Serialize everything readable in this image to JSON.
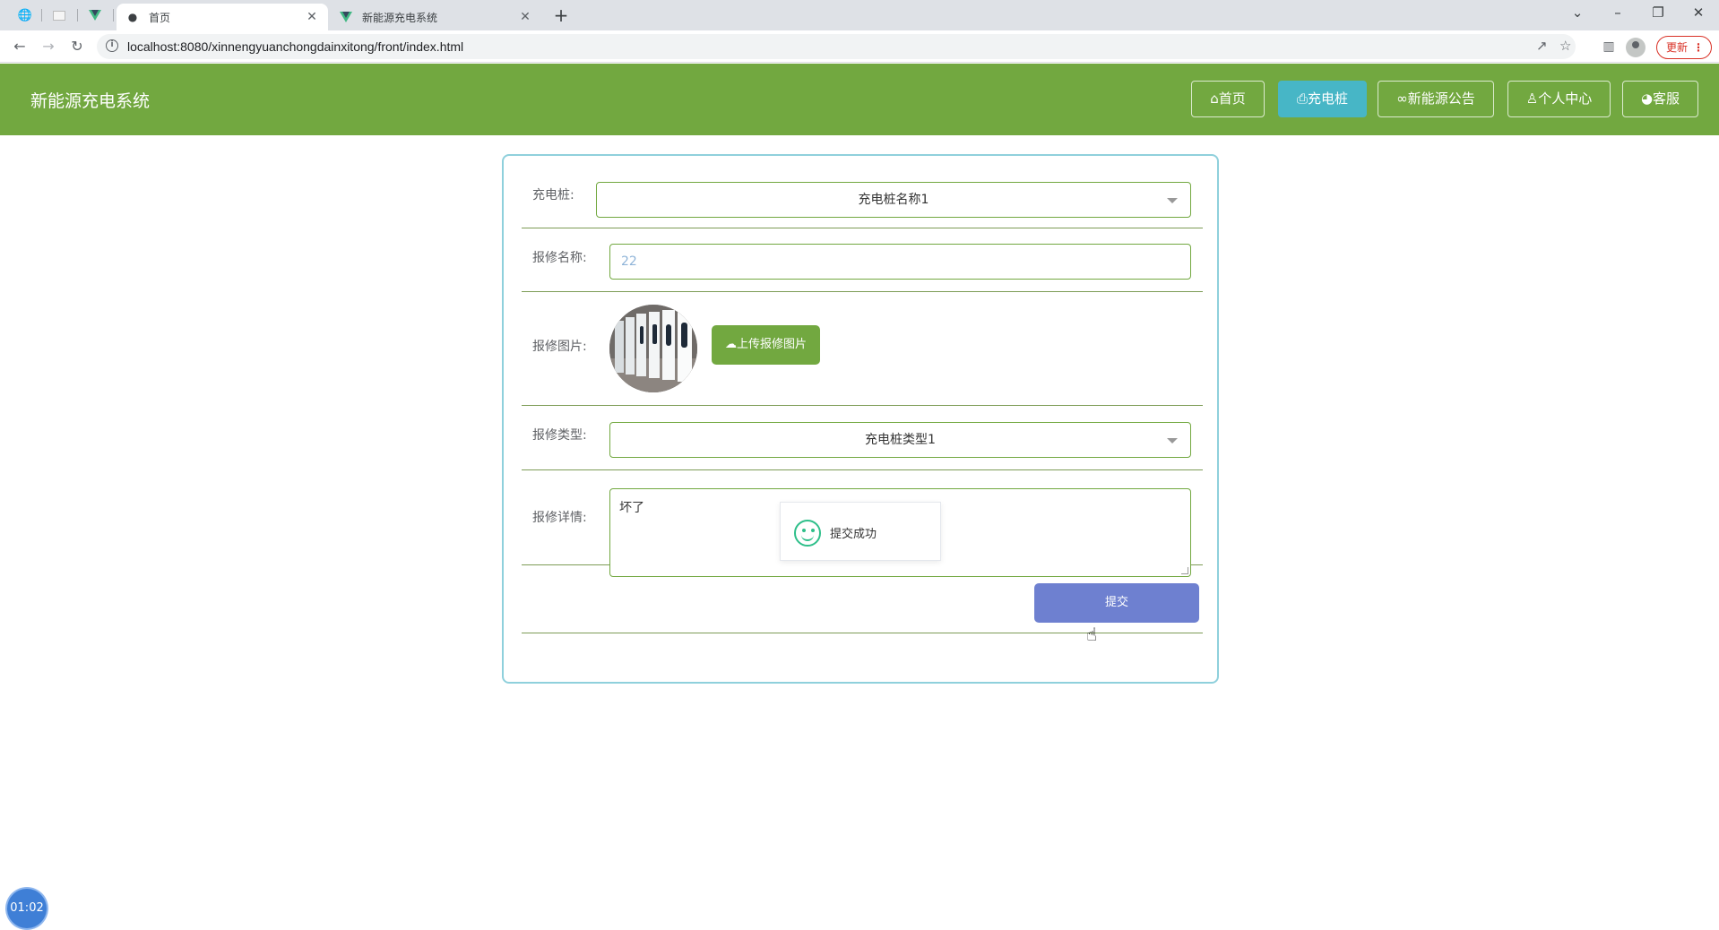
{
  "browser": {
    "tabs": [
      {
        "title": "首页",
        "active": true
      },
      {
        "title": "新能源充电系统",
        "active": false
      }
    ],
    "url": "localhost:8080/xinnengyuanchongdainxitong/front/index.html",
    "update_label": "更新",
    "window_controls": [
      "chevron-down-icon",
      "minimize-icon",
      "restore-icon",
      "close-icon"
    ]
  },
  "header": {
    "title": "新能源充电系统",
    "nav": [
      {
        "label": "首页",
        "icon": "home-icon",
        "active": false
      },
      {
        "label": "充电桩",
        "icon": "printer-icon",
        "active": true
      },
      {
        "label": "新能源公告",
        "icon": "link-icon",
        "active": false
      },
      {
        "label": "个人中心",
        "icon": "user-icon",
        "active": false
      },
      {
        "label": "客服",
        "icon": "headset-icon",
        "active": false
      }
    ],
    "colors": {
      "bar": "#72a840",
      "active": "#47b6c6"
    }
  },
  "form": {
    "station": {
      "label": "充电桩:",
      "value": "充电桩名称1"
    },
    "repair_name": {
      "label": "报修名称:",
      "value": "22"
    },
    "repair_image": {
      "label": "报修图片:",
      "upload_label": "上传报修图片"
    },
    "repair_type": {
      "label": "报修类型:",
      "value": "充电桩类型1"
    },
    "repair_detail": {
      "label": "报修详情:",
      "value": "坏了"
    },
    "submit_label": "提交",
    "submit_color": "#6e80d0"
  },
  "toast": {
    "message": "提交成功",
    "icon": "smile-icon"
  },
  "timer": "01:02"
}
